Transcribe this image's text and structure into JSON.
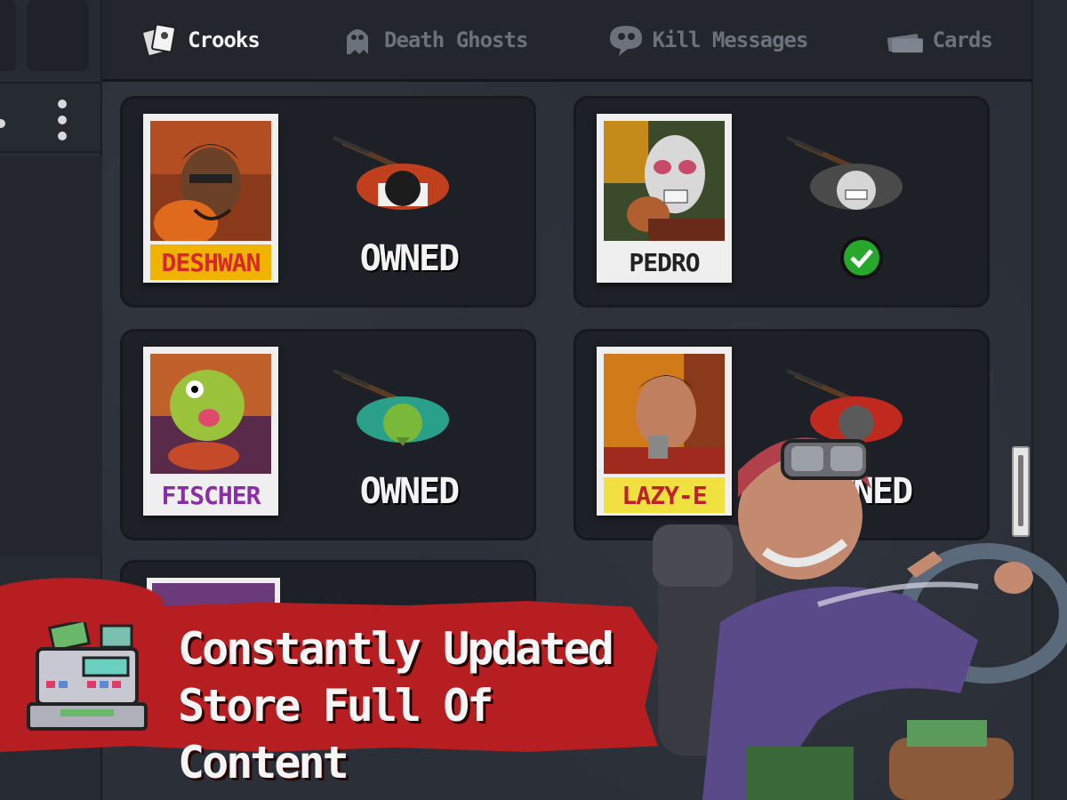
{
  "tabs": [
    {
      "label": "Crooks",
      "icon": "cards-stack-icon",
      "active": true
    },
    {
      "label": "Death Ghosts",
      "icon": "ghost-icon",
      "active": false
    },
    {
      "label": "Kill Messages",
      "icon": "skull-bubble-icon",
      "active": false
    },
    {
      "label": "Cards",
      "icon": "card-icon",
      "active": false
    }
  ],
  "crooks": [
    {
      "name": "DESHWAN",
      "status": "OWNED",
      "name_color": "#d8262a",
      "tag_color": "#f0b400",
      "equipped": false
    },
    {
      "name": "PEDRO",
      "status": "",
      "name_color": "#222222",
      "tag_color": "#efefef",
      "equipped": true
    },
    {
      "name": "FISCHER",
      "status": "OWNED",
      "name_color": "#8a2da6",
      "tag_color": "#efefef",
      "equipped": false
    },
    {
      "name": "LAZY-E",
      "status": "OWNED",
      "name_color": "#c0202a",
      "tag_color": "#f0e040",
      "equipped": false
    }
  ],
  "banner": {
    "line1": "Constantly Updated",
    "line2": "Store Full Of Content"
  },
  "colors": {
    "banner_red": "#b71e22",
    "check_green": "#27a82c",
    "active_tab": "#f2f2f2",
    "inactive_tab": "#6c727b"
  }
}
